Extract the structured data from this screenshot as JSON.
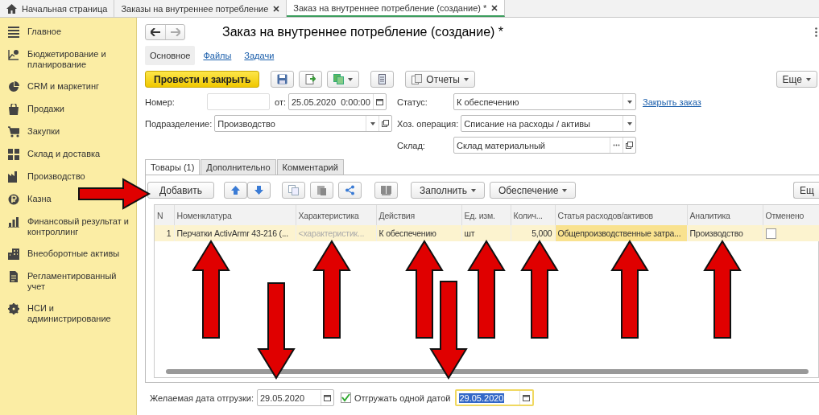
{
  "window_tabs": [
    {
      "label": "Начальная страница",
      "kind": "home",
      "selected": false
    },
    {
      "label": "Заказы на внутреннее потребление",
      "kind": "closable",
      "selected": false
    },
    {
      "label": "Заказ на внутреннее потребление (создание) *",
      "kind": "closable",
      "selected": true
    }
  ],
  "sidebar": {
    "items": [
      {
        "label": "Главное"
      },
      {
        "label": "Бюджетирование и планирование"
      },
      {
        "label": "CRM и маркетинг"
      },
      {
        "label": "Продажи"
      },
      {
        "label": "Закупки"
      },
      {
        "label": "Склад и доставка"
      },
      {
        "label": "Производство"
      },
      {
        "label": "Казна"
      },
      {
        "label": "Финансовый результат и контроллинг"
      },
      {
        "label": "Внеоборотные активы"
      },
      {
        "label": "Регламентированный учет"
      },
      {
        "label": "НСИ и администрирование"
      }
    ]
  },
  "form": {
    "title": "Заказ на внутреннее потребление (создание) *",
    "sections": [
      {
        "label": "Основное",
        "selected": true
      },
      {
        "label": "Файлы",
        "selected": false
      },
      {
        "label": "Задачи",
        "selected": false
      }
    ],
    "toolbar": {
      "primary": "Провести и закрыть",
      "reports": "Отчеты",
      "more": "Еще"
    },
    "fields": {
      "number": {
        "label": "Номер:"
      },
      "date": {
        "label": "от:",
        "value": "25.05.2020  0:00:00"
      },
      "status": {
        "label": "Статус:",
        "value": "К обеспечению"
      },
      "close_link": "Закрыть заказ",
      "department": {
        "label": "Подразделение:",
        "value": "Производство"
      },
      "operation": {
        "label": "Хоз. операция:",
        "value": "Списание на расходы / активы"
      },
      "warehouse": {
        "label": "Склад:",
        "value": "Склад материальный"
      }
    },
    "tabs": [
      {
        "label": "Товары (1)",
        "selected": true
      },
      {
        "label": "Дополнительно",
        "selected": false
      },
      {
        "label": "Комментарий",
        "selected": false
      }
    ],
    "table_toolbar": {
      "add": "Добавить",
      "fill": "Заполнить",
      "supply": "Обеспечение",
      "more": "Ещ"
    },
    "table": {
      "columns": [
        "N",
        "Номенклатура",
        "Характеристика",
        "Действия",
        "Ед. изм.",
        "Колич...",
        "Статья расходов/активов",
        "Аналитика",
        "Отменено"
      ],
      "rows": [
        {
          "selected": true,
          "cancelled": false,
          "cells": [
            {
              "text": "1",
              "selected": false,
              "muted": false
            },
            {
              "text": "Перчатки ActivArmr 43-216 (...",
              "selected": false,
              "muted": false
            },
            {
              "text": "<характеристик...",
              "selected": false,
              "muted": true
            },
            {
              "text": "К обеспечению",
              "selected": false,
              "muted": false
            },
            {
              "text": "шт",
              "selected": false,
              "muted": false
            },
            {
              "text": "5,000",
              "selected": false,
              "muted": false
            },
            {
              "text": "Общепроизводственные затра...",
              "selected": true,
              "muted": false
            },
            {
              "text": "Производство",
              "selected": false,
              "muted": false
            }
          ]
        }
      ]
    },
    "shipping": {
      "label": "Желаемая дата отгрузки:",
      "date": "29.05.2020",
      "single_date": {
        "label": "Отгружать одной датой",
        "checked": true
      },
      "single_date_value": "29.05.2020"
    }
  },
  "annotations": [
    {
      "kind": "right"
    },
    {
      "kind": "up"
    },
    {
      "kind": "up"
    },
    {
      "kind": "up"
    },
    {
      "kind": "up"
    },
    {
      "kind": "up"
    },
    {
      "kind": "up"
    },
    {
      "kind": "up"
    },
    {
      "kind": "down"
    },
    {
      "kind": "down"
    }
  ]
}
